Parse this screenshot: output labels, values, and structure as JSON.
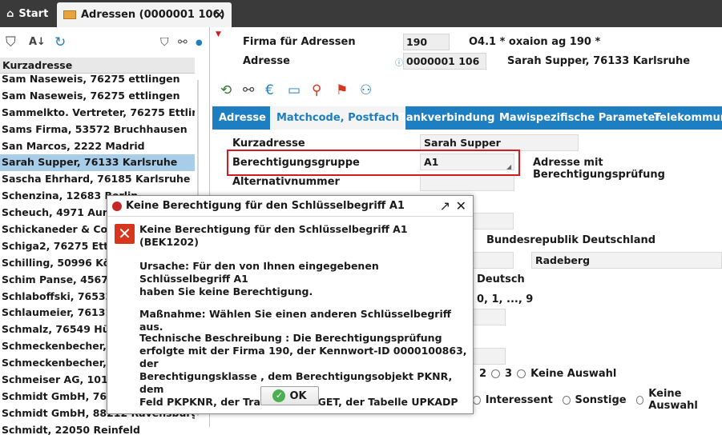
{
  "tabs": {
    "start_label": "Start",
    "address_tab_label": "Adressen (0000001 106)",
    "close_glyph": "✕"
  },
  "left_panel": {
    "column_header": "Kurzadresse",
    "items": [
      "Sam Naseweis, 76275 ettlingen",
      "Sam Naseweis, 76275 ettlingen",
      "Sammelkto. Vertreter, 76275 Ettlinge",
      "Sams Firma, 53572 Bruchhausen",
      "San Marcos, 2222 Madrid",
      "Sarah Supper, 76133 Karlsruhe",
      "Sascha Ehrhard, 76185 Karlsruhe",
      "Schenzina, 12683 Berlin",
      "Scheuch, 4971 Auro",
      "Schickaneder & Co.,",
      "Schiga2, 76275 Ettli",
      "Schilling, 50996 Köln",
      "Schim Panse, 4567",
      "Schlaboffski, 76532",
      "Schlaumeier, 76131",
      "Schmalz, 76549 Hüg",
      "Schmeckenbecher, 7",
      "Schmeckenbecher, 7",
      "Schmeiser AG, 1010",
      "Schmidt GmbH, 7613",
      "Schmidt GmbH, 88212 Ravensburg",
      "Schmidt, 22050 Reinfeld"
    ],
    "selected_index": 5
  },
  "header": {
    "firma_label": "Firma für Adressen",
    "firma_value": "190",
    "firma_desc": "O4.1 * oxaion ag 190   *",
    "adresse_label": "Adresse",
    "adresse_value": "0000001 106",
    "adresse_desc": "Sarah Supper, 76133 Karlsruhe"
  },
  "subtabs": [
    "Adresse",
    "Matchcode, Postfach",
    "Bankverbindung",
    "Mawispezifische Parameter",
    "Telekommuni"
  ],
  "form": {
    "kurzadresse_label": "Kurzadresse",
    "kurzadresse_value": "Sarah Supper",
    "berechtigung_label": "Berechtigungsgruppe",
    "berechtigung_value": "A1",
    "berechtigung_note": "Adresse mit Berechtigungsprüfung",
    "alternativ_label": "Alternativnummer",
    "country_value": "Bundesrepublik Deutschland",
    "city_value": "Radeberg",
    "language_value": "Deutsch",
    "digits_value": "0, 1, ..., 9",
    "radio1": [
      "2",
      "3",
      "Keine Auswahl"
    ],
    "radio2": [
      "Interessent",
      "Sonstige",
      "Keine Auswahl"
    ]
  },
  "dialog": {
    "title": "Keine Berechtigung für den Schlüsselbegriff A1",
    "heading": "Keine Berechtigung für den Schlüsselbegriff A1 (BEK1202)",
    "ursache": "Ursache: Für den von Ihnen eingegebenen Schlüsselbegriff A1\nhaben Sie keine Berechtigung.",
    "massnahme": "Maßnahme: Wählen Sie einen anderen Schlüsselbegriff aus.",
    "technik": "Technische Beschreibung : Die Berechtigungsprüfung\nerfolgte mit der Firma 190, der Kennwort-ID 0000100863, der\nBerechtigungsklasse , dem Berechtigungsobjekt PKNR, dem\nFeld PKPKNR, der Transaktion *GET, der Tabelle UPKADP",
    "ok_label": "OK"
  },
  "colors": {
    "accent": "#1d7fc1",
    "selection": "#a8cde8",
    "highlight": "#d71920",
    "error": "#d9351c"
  }
}
